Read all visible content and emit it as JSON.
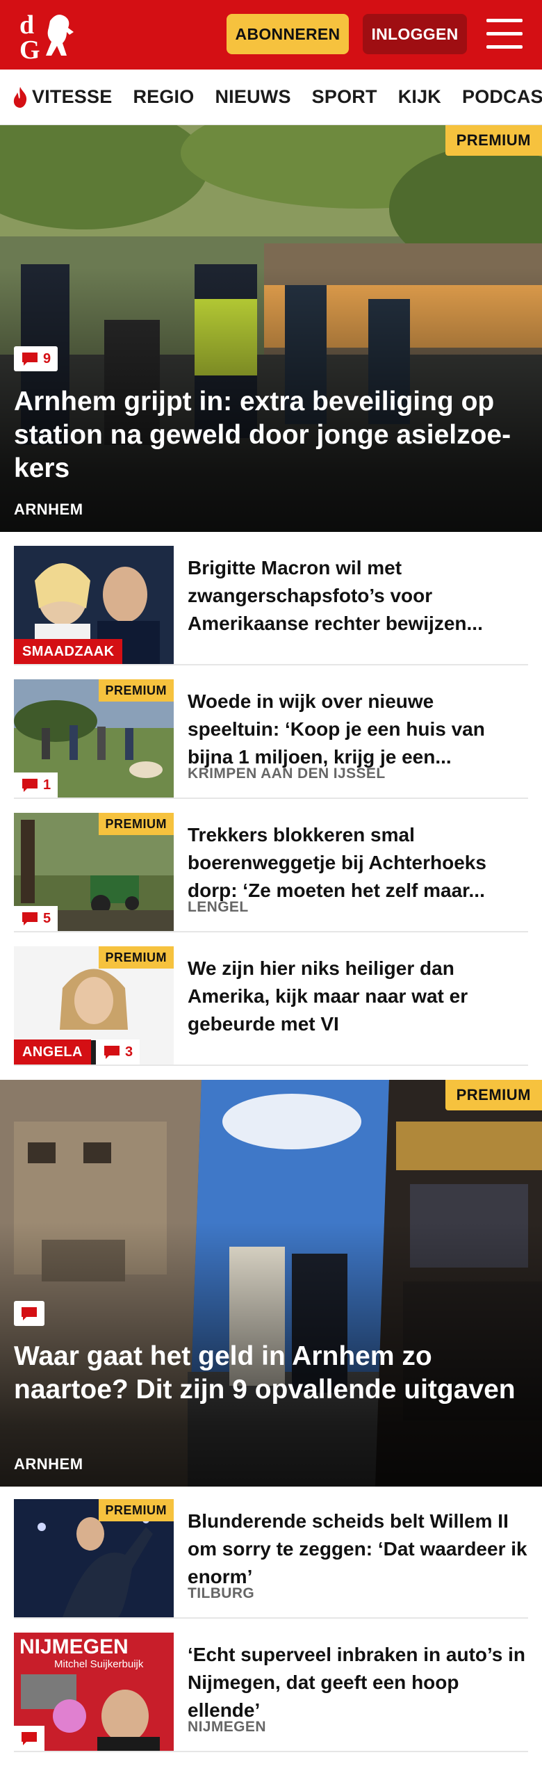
{
  "header": {
    "subscribe_label": "ABONNEREN",
    "login_label": "INLOGGEN",
    "brand_color": "#d40f14"
  },
  "nav": {
    "items": [
      {
        "label": "VITESSE",
        "icon": "flame-icon"
      },
      {
        "label": "REGIO"
      },
      {
        "label": "NIEUWS"
      },
      {
        "label": "SPORT"
      },
      {
        "label": "KIJK"
      },
      {
        "label": "PODCAST"
      }
    ]
  },
  "premium_label": "PREMIUM",
  "hero1": {
    "comments": "9",
    "title": "Arnhem grijpt in: extra beveiliging op station na geweld door jonge asielzoe-kers",
    "location": "ARNHEM"
  },
  "articles1": [
    {
      "title": "Brigitte Macron wil met zwangerschapsfoto’s voor Amerikaanse rechter bewijzen...",
      "tag": "SMAADZAAK"
    },
    {
      "title": "Woede in wijk over nieuwe speeltuin: ‘Koop je een huis van bijna 1 miljoen, krijg je een...",
      "location": "KRIMPEN AAN DEN IJSSEL",
      "comments": "1",
      "premium": true
    },
    {
      "title": "Trekkers blokkeren smal boerenweggetje bij Achterhoeks dorp: ‘Ze moeten het zelf maar...",
      "location": "LENGEL",
      "comments": "5",
      "premium": true
    },
    {
      "title": "We zijn hier niks heiliger dan Amerika, kijk maar naar wat er gebeurde met VI",
      "tag": "ANGELA",
      "comments": "3",
      "premium": true
    }
  ],
  "hero2": {
    "title": "Waar gaat het geld in Arnhem zo naartoe? Dit zijn 9 opvallende uitgaven",
    "location": "ARNHEM"
  },
  "articles2": [
    {
      "title": "Blunderende scheids belt Willem II om sorry te zeggen: ‘Dat waardeer ik enorm’",
      "location": "TILBURG",
      "premium": true
    },
    {
      "title": "‘Echt superveel inbraken in auto’s in Nijmegen, dat geeft een hoop ellende’",
      "location": "NIJMEGEN",
      "thumb_text": "NIJMEGEN",
      "thumb_sub": "Mitchel Suijkerbuijk"
    }
  ]
}
